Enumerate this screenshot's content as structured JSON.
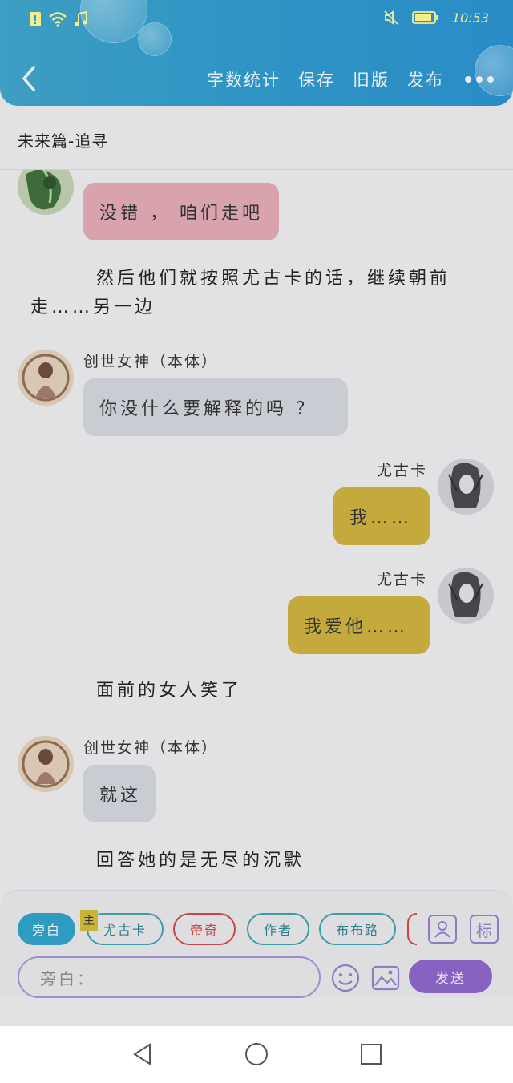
{
  "status_bar": {
    "time": "10:53"
  },
  "toolbar": {
    "word_count": "字数统计",
    "save": "保存",
    "old_version": "旧版",
    "publish": "发布"
  },
  "chapter": {
    "title": "未来篇-追寻"
  },
  "messages": [
    {
      "type": "bubble",
      "side": "left",
      "speaker": "",
      "text": "没错 ， 咱们走吧",
      "color": "#d8a3ad"
    },
    {
      "type": "narration",
      "text": "然后他们就按照尤古卡的话，继续朝前走……另一边"
    },
    {
      "type": "bubble",
      "side": "left",
      "speaker": "创世女神（本体）",
      "text": "你没什么要解释的吗 ？",
      "color": "#c9ccd3"
    },
    {
      "type": "bubble",
      "side": "right",
      "speaker": "尤古卡",
      "text": "我……",
      "color": "#c4aa3d"
    },
    {
      "type": "bubble",
      "side": "right",
      "speaker": "尤古卡",
      "text": "我爱他……",
      "color": "#c4aa3d"
    },
    {
      "type": "narration",
      "text": "面前的女人笑了"
    },
    {
      "type": "bubble",
      "side": "left",
      "speaker": "创世女神（本体）",
      "text": "就这",
      "color": "#c9ccd3"
    },
    {
      "type": "narration",
      "text": "回答她的是无尽的沉默"
    }
  ],
  "roles": {
    "narrator": "旁白",
    "master_tag": "主",
    "role_1": "尤古卡",
    "role_2": "帝奇",
    "role_3": "作者",
    "role_4": "布布路"
  },
  "input": {
    "placeholder": "旁白：",
    "send": "发送",
    "tag_icon_text": "标"
  },
  "colors": {
    "header": "#2f95c4",
    "send": "#8862c0",
    "narrator_chip": "#2f9bc1"
  }
}
